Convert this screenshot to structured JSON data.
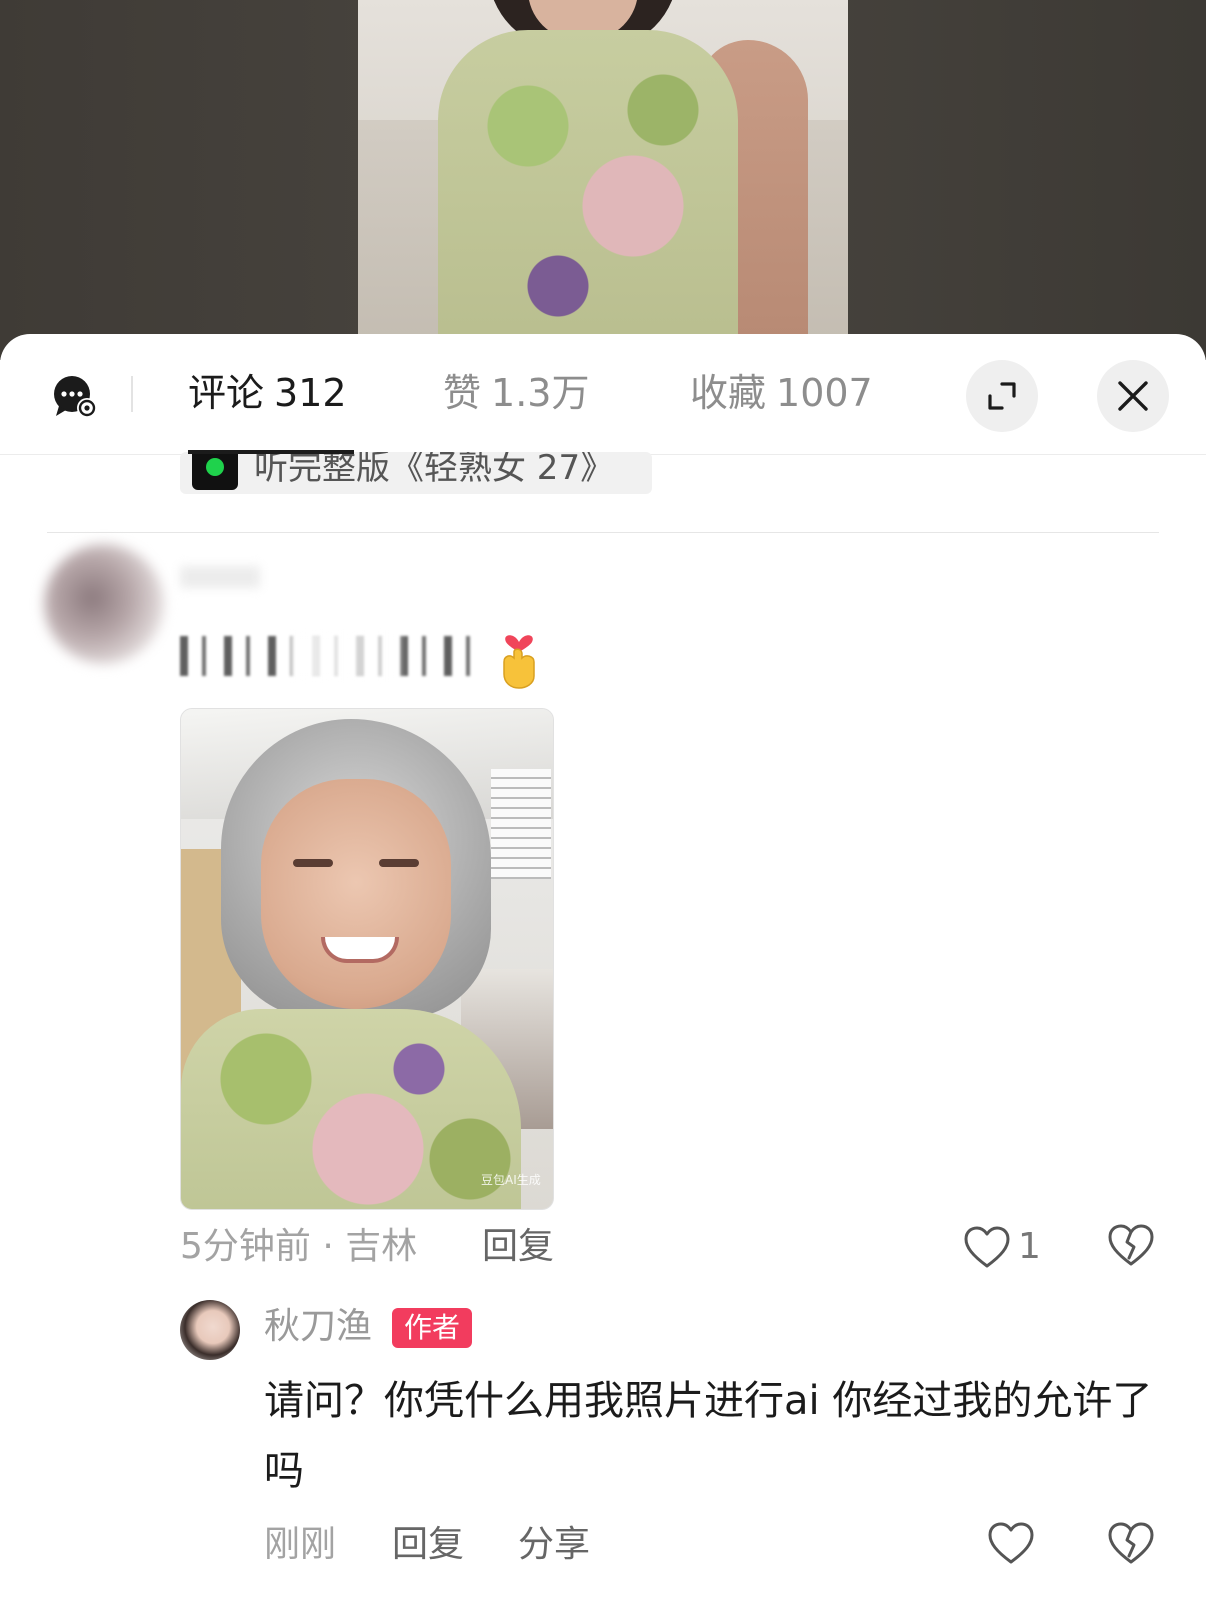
{
  "tabs": {
    "comments_label": "评论",
    "comments_count": "312",
    "likes_label": "赞",
    "likes_count": "1.3万",
    "favorites_label": "收藏",
    "favorites_count": "1007"
  },
  "icons": {
    "header": [
      "chat-settings-icon",
      "expand-icon",
      "close-icon"
    ],
    "comment_actions": [
      "heart-icon",
      "broken-heart-icon"
    ],
    "emoji": "finger-heart-emoji"
  },
  "music_tag": {
    "text": "听完整版《轻熟女 27》"
  },
  "comment": {
    "image_watermark": "豆包AI生成",
    "time_location": "5分钟前 · 吉林",
    "reply_label": "回复",
    "like_count": "1"
  },
  "reply": {
    "username": "秋刀渔",
    "badge": "作者",
    "text": "请问？你凭什么用我照片进行ai 你经过我的允许了吗",
    "time": "刚刚",
    "reply_label": "回复",
    "share_label": "分享"
  },
  "colors": {
    "author_badge": "#f23c5e",
    "muted_text": "#a3a3a3",
    "primary_text": "#1b1b1b"
  }
}
